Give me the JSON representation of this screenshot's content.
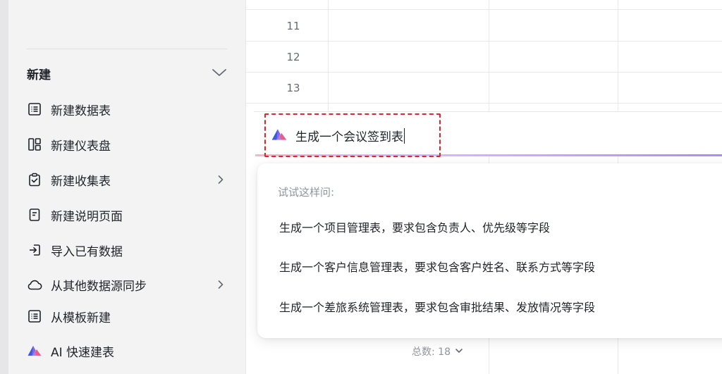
{
  "sidebar": {
    "section_title": "新建",
    "items": [
      {
        "label": "新建数据表",
        "icon": "list-table-icon",
        "has_submenu": false
      },
      {
        "label": "新建仪表盘",
        "icon": "dashboard-icon",
        "has_submenu": false
      },
      {
        "label": "新建收集表",
        "icon": "clipboard-check-icon",
        "has_submenu": true
      },
      {
        "label": "新建说明页面",
        "icon": "document-icon",
        "has_submenu": false
      },
      {
        "label": "导入已有数据",
        "icon": "import-icon",
        "has_submenu": false
      },
      {
        "label": "从其他数据源同步",
        "icon": "cloud-icon",
        "has_submenu": true
      },
      {
        "label": "从模板新建",
        "icon": "list-table-icon",
        "has_submenu": false
      },
      {
        "label": "AI 快速建表",
        "icon": "ai-logo-icon",
        "has_submenu": false
      }
    ]
  },
  "grid": {
    "row_numbers": [
      "11",
      "12",
      "13"
    ]
  },
  "ai_input": {
    "value": "生成一个会议签到表"
  },
  "suggestions": {
    "hint": "试试这样问:",
    "items": [
      "生成一个项目管理表，要求包含负责人、优先级等字段",
      "生成一个客户信息管理表，要求包含客户姓名、联系方式等字段",
      "生成一个差旅系统管理表，要求包含审批结果、发放情况等字段"
    ]
  },
  "footer": {
    "total_text": "总数: 18"
  },
  "colors": {
    "highlight_border": "#e0262d",
    "ai_logo_blue": "#3b5bdb",
    "ai_logo_pink": "#e85d8f"
  }
}
